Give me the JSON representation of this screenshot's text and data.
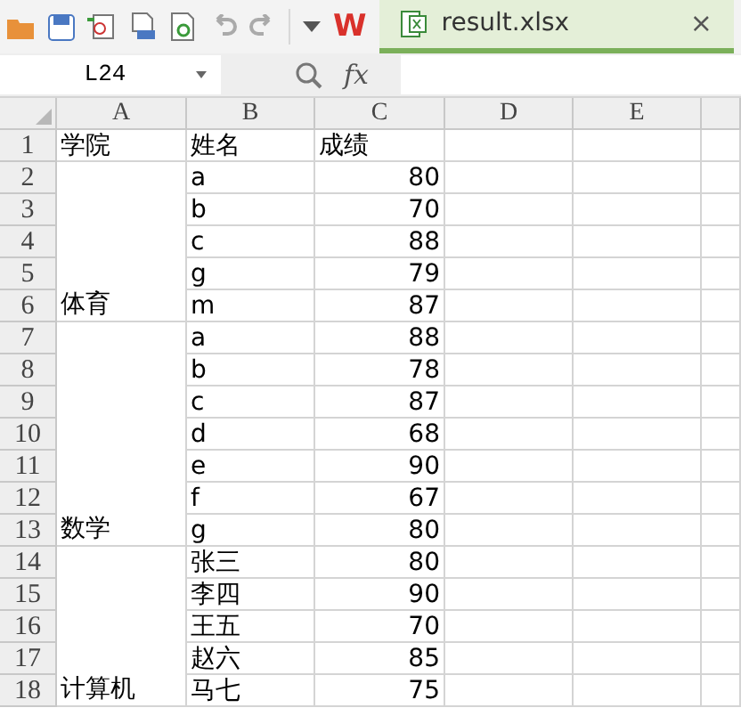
{
  "toolbar": {
    "logo": "W",
    "tab": {
      "title": "result.xlsx",
      "close": "×",
      "selected": true
    }
  },
  "formula_bar": {
    "name_box": "L24",
    "fx": "fx"
  },
  "sheet": {
    "columns": [
      "A",
      "B",
      "C",
      "D",
      "E"
    ],
    "header": {
      "row": "1",
      "cells": [
        "学院",
        "姓名",
        "成绩"
      ]
    },
    "groups": [
      {
        "college": "体育",
        "rows": [
          {
            "row": "2",
            "name": "a",
            "score": "80"
          },
          {
            "row": "3",
            "name": "b",
            "score": "70"
          },
          {
            "row": "4",
            "name": "c",
            "score": "88"
          },
          {
            "row": "5",
            "name": "g",
            "score": "79"
          },
          {
            "row": "6",
            "name": "m",
            "score": "87"
          }
        ]
      },
      {
        "college": "数学",
        "rows": [
          {
            "row": "7",
            "name": "a",
            "score": "88"
          },
          {
            "row": "8",
            "name": "b",
            "score": "78"
          },
          {
            "row": "9",
            "name": "c",
            "score": "87"
          },
          {
            "row": "10",
            "name": "d",
            "score": "68"
          },
          {
            "row": "11",
            "name": "e",
            "score": "90"
          },
          {
            "row": "12",
            "name": "f",
            "score": "67"
          },
          {
            "row": "13",
            "name": "g",
            "score": "80"
          }
        ]
      },
      {
        "college": "计算机",
        "rows": [
          {
            "row": "14",
            "name": "张三",
            "score": "80"
          },
          {
            "row": "15",
            "name": "李四",
            "score": "90"
          },
          {
            "row": "16",
            "name": "王五",
            "score": "70"
          },
          {
            "row": "17",
            "name": "赵六",
            "score": "85"
          },
          {
            "row": "18",
            "name": "马七",
            "score": "75"
          }
        ]
      }
    ]
  }
}
